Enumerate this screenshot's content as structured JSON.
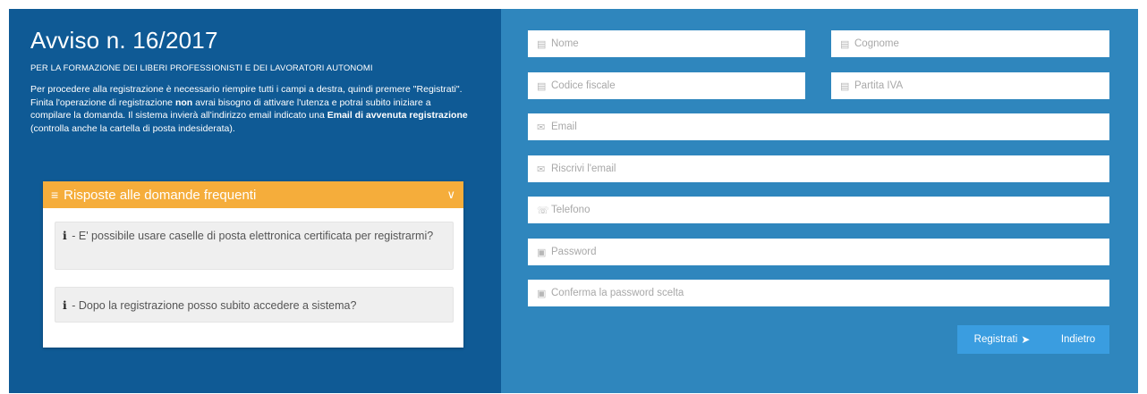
{
  "left": {
    "title": "Avviso n. 16/2017",
    "subtitle": "PER LA FORMAZIONE DEI LIBERI PROFESSIONISTI E DEI LAVORATORI AUTONOMI",
    "desc_1": "Per procedere alla registrazione è necessario riempire tutti i campi a destra, quindi premere \"Registrati\". Finita l'operazione di registrazione ",
    "desc_bold_1": "non",
    "desc_2": " avrai bisogno di attivare l'utenza e potrai subito iniziare a compilare la domanda. Il sistema invierà all'indirizzo email indicato una ",
    "desc_bold_2": "Email di avvenuta registrazione",
    "desc_3": " (controlla anche la cartella di posta indesiderata)."
  },
  "faq": {
    "header": "Risposte alle domande frequenti",
    "items": [
      {
        "icon": "i",
        "text": " - E' possibile usare caselle di posta elettronica certificata per registrarmi?"
      },
      {
        "icon": "i",
        "text": " - Dopo la registrazione posso subito accedere a sistema?"
      }
    ]
  },
  "form": {
    "nome": "Nome",
    "cognome": "Cognome",
    "codice_fiscale": "Codice fiscale",
    "partita_iva": "Partita IVA",
    "email": "Email",
    "email_confirm": "Riscrivi l'email",
    "telefono": "Telefono",
    "password": "Password",
    "password_confirm": "Conferma la password scelta"
  },
  "buttons": {
    "register": "Registrati",
    "back": "Indietro"
  },
  "colors": {
    "banner": "#0f5a95",
    "panel": "#2f86bd",
    "faq_header": "#f5ad3b",
    "button": "#3a9de0"
  }
}
